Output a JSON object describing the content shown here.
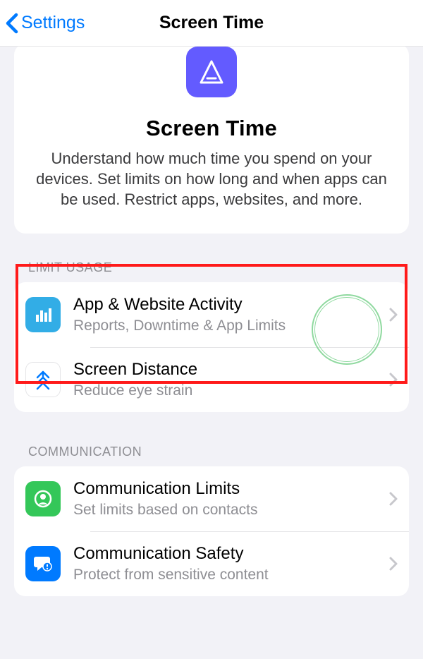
{
  "nav": {
    "back_label": "Settings",
    "title": "Screen Time"
  },
  "hero": {
    "title": "Screen Time",
    "desc": "Understand how much time you spend on your devices. Set limits on how long and when apps can be used. Restrict apps, websites, and more."
  },
  "sections": {
    "limit_usage": {
      "header": "LIMIT USAGE",
      "items": [
        {
          "title": "App & Website Activity",
          "sub": "Reports, Downtime & App Limits"
        },
        {
          "title": "Screen Distance",
          "sub": "Reduce eye strain"
        }
      ]
    },
    "communication": {
      "header": "COMMUNICATION",
      "items": [
        {
          "title": "Communication Limits",
          "sub": "Set limits based on contacts"
        },
        {
          "title": "Communication Safety",
          "sub": "Protect from sensitive content"
        }
      ]
    }
  }
}
